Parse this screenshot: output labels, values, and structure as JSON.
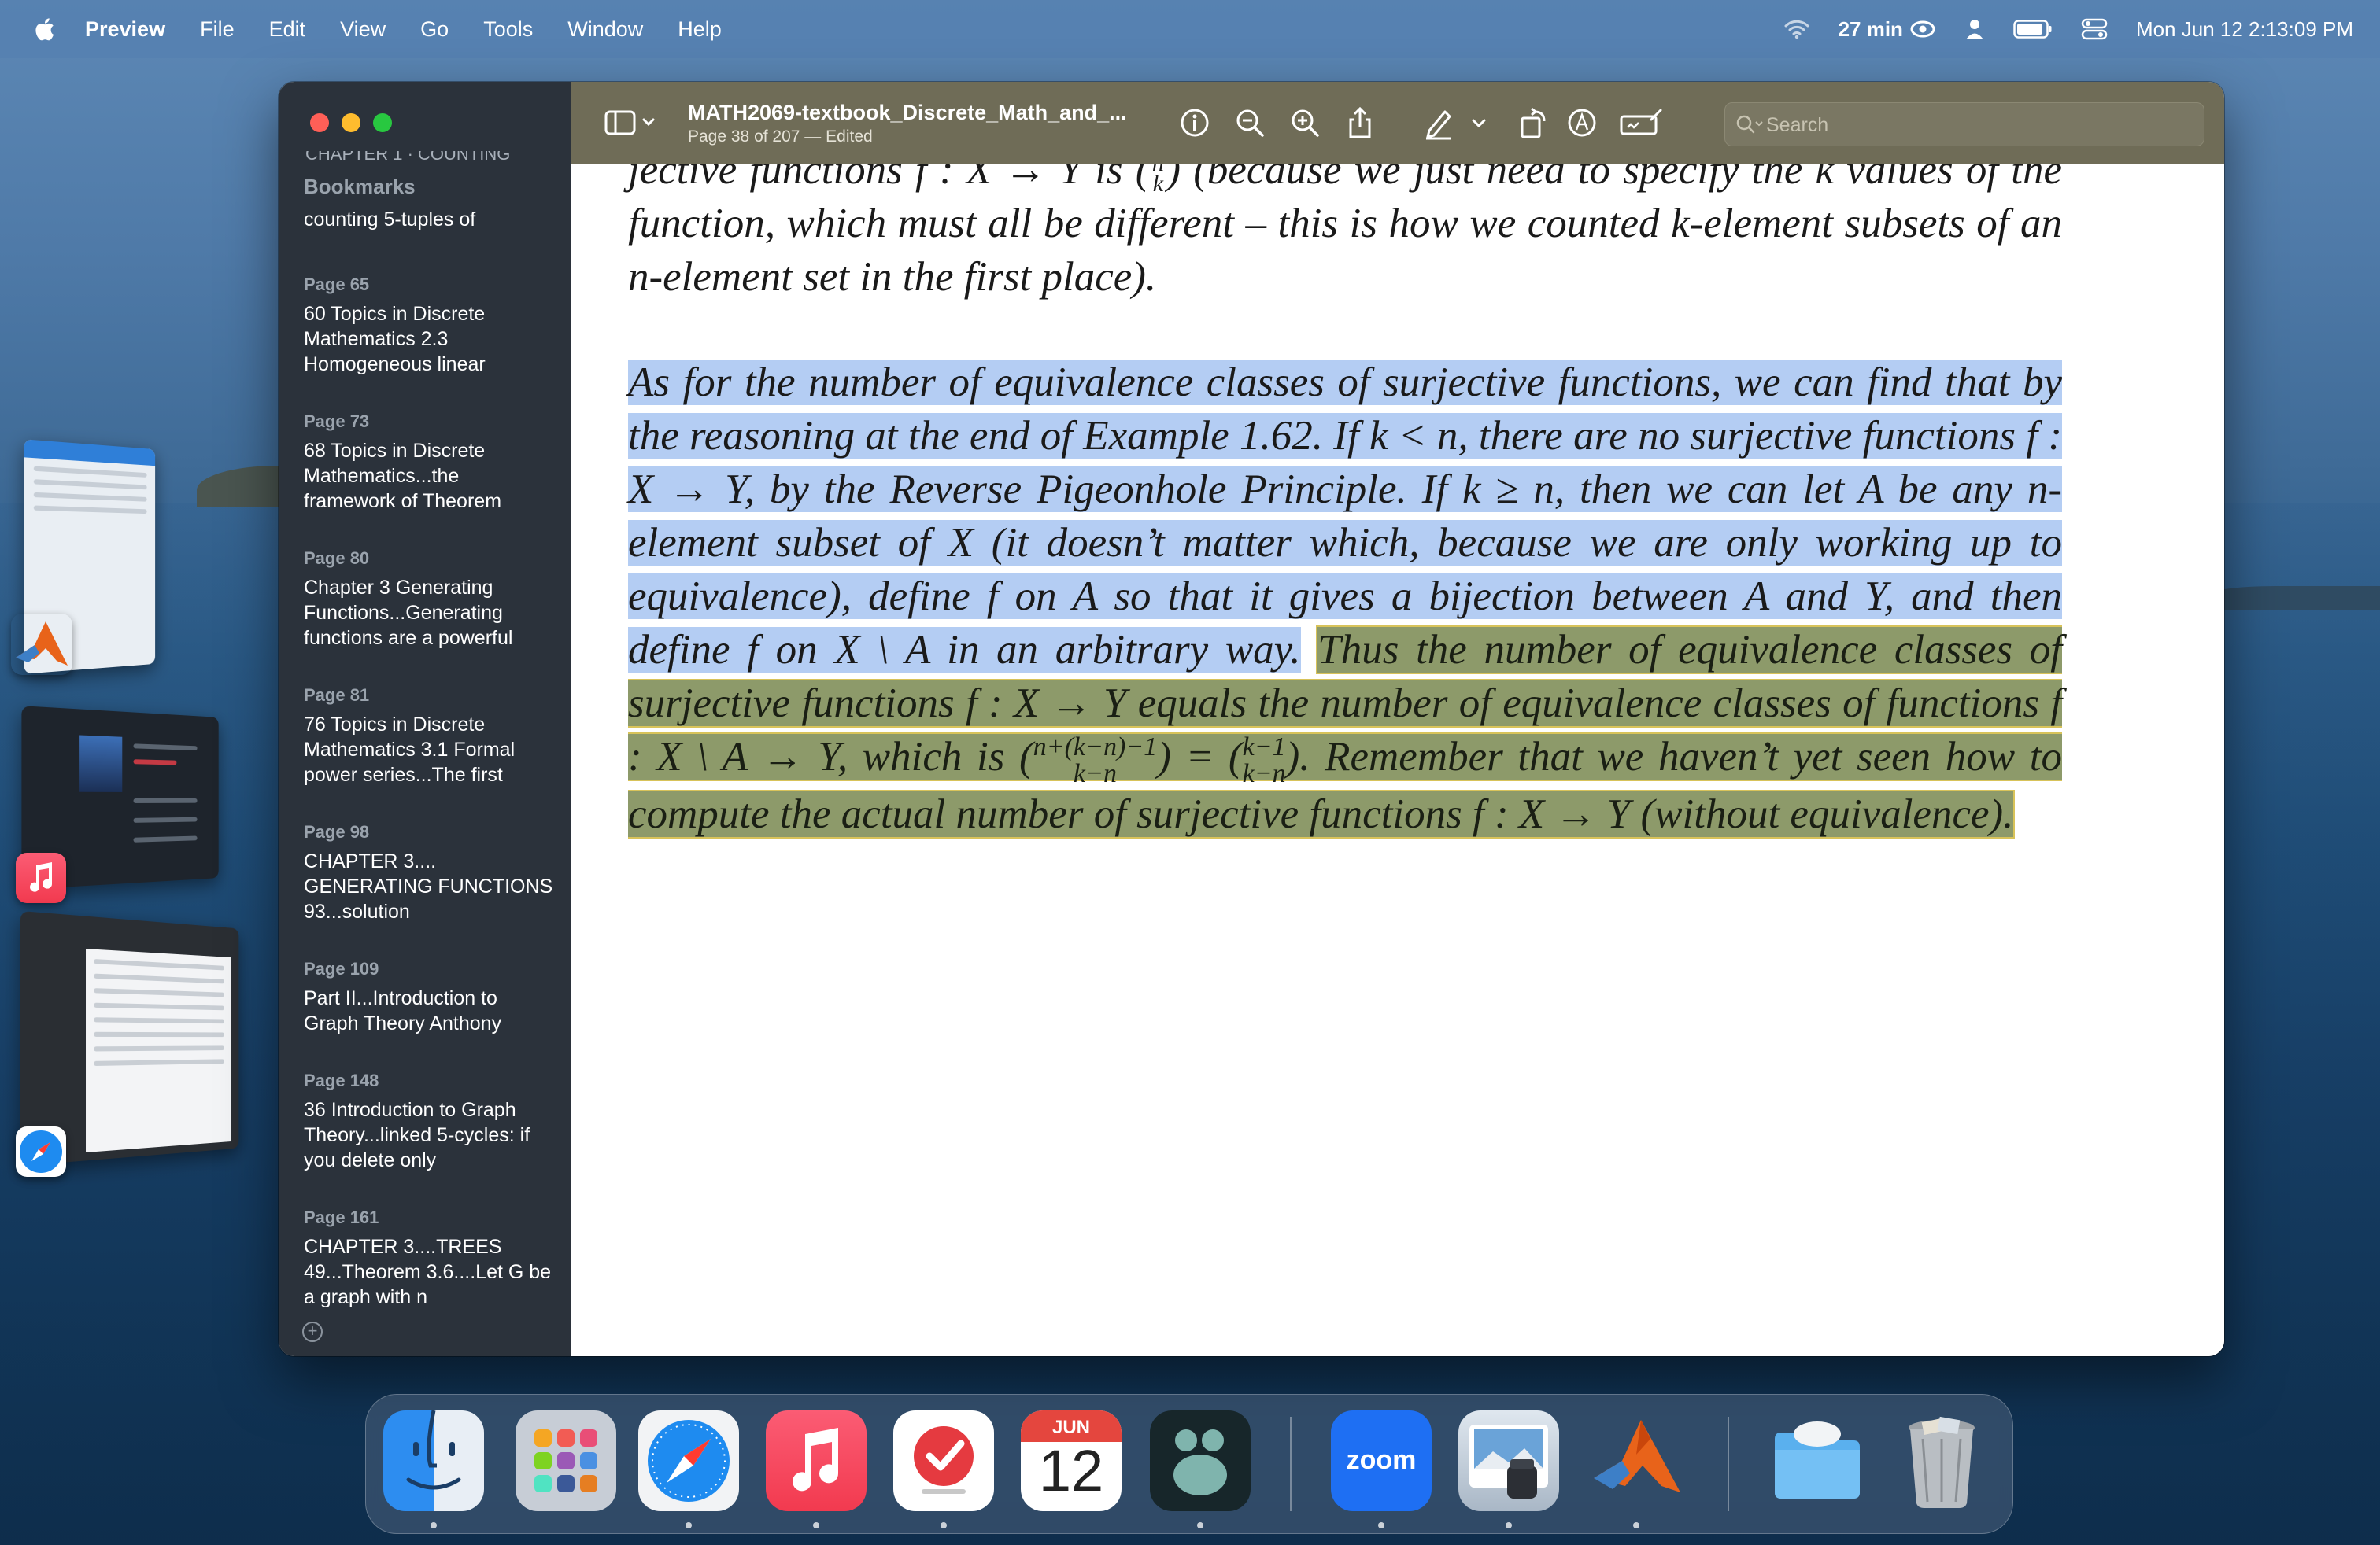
{
  "menubar": {
    "app_name": "Preview",
    "items": [
      "File",
      "Edit",
      "View",
      "Go",
      "Tools",
      "Window",
      "Help"
    ],
    "battery_time": "27 min",
    "clock": "Mon Jun 12  2:13:09 PM"
  },
  "window": {
    "title": "MATH2069-textbook_Discrete_Math_and_...",
    "subtitle": "Page 38 of 207 — Edited",
    "search_placeholder": "Search"
  },
  "sidebar": {
    "cut_top": "CHAPTER 1 · COUNTING",
    "heading": "Bookmarks",
    "first_text": "counting 5-tuples of",
    "bookmarks": [
      {
        "page": "Page 65",
        "text": "60 Topics in Discrete Mathematics 2.3 Homogeneous linear"
      },
      {
        "page": "Page 73",
        "text": "68 Topics in Discrete Mathematics...the framework of Theorem"
      },
      {
        "page": "Page 80",
        "text": "Chapter 3 Generating Functions...Generating functions are a powerful"
      },
      {
        "page": "Page 81",
        "text": "76 Topics in Discrete Mathematics 3.1 Formal power series...The first"
      },
      {
        "page": "Page 98",
        "text": "CHAPTER 3.... GENERATING FUNCTIONS 93...solution"
      },
      {
        "page": "Page 109",
        "text": "Part II...Introduction to Graph Theory Anthony"
      },
      {
        "page": "Page 148",
        "text": "36 Introduction to Graph Theory...linked 5-cycles: if you delete only"
      },
      {
        "page": "Page 161",
        "text": "CHAPTER 3....TREES 49...Theorem 3.6....Let G be a graph with n"
      }
    ]
  },
  "document": {
    "p1_a": "jective functions f : X → Y is (",
    "p1_binom": "n k",
    "p1_b": ") (because we just need to specify the k values of the function, which must all be different – this is how we counted k-element subsets of an n-element set in the first place).",
    "p2_blue": "As for the number of equivalence classes of surjective functions, we can find that by the reasoning at the end of Example 1.62. If k < n, there are no surjective functions f : X → Y, by the Reverse Pigeonhole Principle. If k ≥ n, then we can let A be any n-element subset of X (it doesn’t matter which, because we are only working up to equivalence), define f on A so that it gives a bijection between A and Y, and then define f on X \\ A in an arbitrary way.",
    "p2_olive_a": "Thus the number of equivalence classes of surjective functions f : X → Y equals the number of equivalence classes of functions f : X \\ A → Y, which is ",
    "binom1_top": "n+(k−n)−1",
    "binom1_bottom": "k−n",
    "equals": " = ",
    "binom2_top": "k−1",
    "binom2_bottom": "k−n",
    "p2_olive_b": ". Remember that we haven’t yet seen how to compute the actual number of surjective functions f : X → Y (without equivalence)."
  },
  "dock": {
    "items": [
      "Finder",
      "Launchpad",
      "Safari",
      "Music",
      "Reminders",
      "Calendar",
      "Mastodon",
      "Zoom",
      "Preview",
      "MATLAB",
      "Downloads",
      "Trash"
    ],
    "calendar_month": "JUN",
    "calendar_day": "12",
    "zoom_label": "zoom"
  },
  "colors": {
    "toolbar": "#6f6c57",
    "sidebar": "#2b323b",
    "highlight_blue": "#b4cdf3",
    "highlight_olive": "#8d9a6a",
    "highlight_border": "#d8c35a"
  }
}
